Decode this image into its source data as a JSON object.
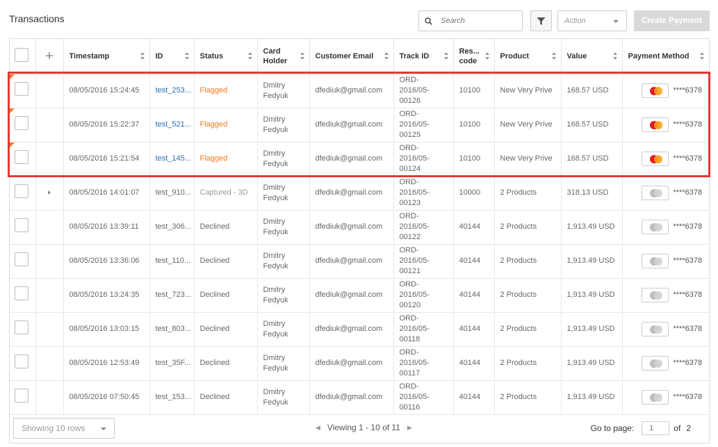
{
  "header": {
    "title": "Transactions",
    "search_placeholder": "Search",
    "action_label": "Action",
    "create_label": "Create Payment"
  },
  "columns": [
    "Timestamp",
    "ID",
    "Status",
    "Card Holder",
    "Customer Email",
    "Track ID",
    "Res... code",
    "Product",
    "Value",
    "Payment Method"
  ],
  "rows": [
    {
      "timestamp": "08/05/2016 15:24:45",
      "id": "test_253...",
      "status": "Flagged",
      "holder": "Dmitry Fedyuk",
      "email": "dfediuk@gmail.com",
      "track": "ORD-2016/05-00126",
      "code": "10100",
      "product": "New Very Prive",
      "value": "168.57 USD",
      "card": "****6378",
      "flagged": true
    },
    {
      "timestamp": "08/05/2016 15:22:37",
      "id": "test_521...",
      "status": "Flagged",
      "holder": "Dmitry Fedyuk",
      "email": "dfediuk@gmail.com",
      "track": "ORD-2016/05-00125",
      "code": "10100",
      "product": "New Very Prive",
      "value": "168.57 USD",
      "card": "****6378",
      "flagged": true
    },
    {
      "timestamp": "08/05/2016 15:21:54",
      "id": "test_145...",
      "status": "Flagged",
      "holder": "Dmitry Fedyuk",
      "email": "dfediuk@gmail.com",
      "track": "ORD-2016/05-00124",
      "code": "10100",
      "product": "New Very Prive",
      "value": "168.57 USD",
      "card": "****6378",
      "flagged": true
    },
    {
      "timestamp": "08/05/2016 14:01:07",
      "id": "test_910...",
      "status": "Captured - 3D",
      "holder": "Dmitry Fedyuk",
      "email": "dfediuk@gmail.com",
      "track": "ORD-2016/05-00123",
      "code": "10000",
      "product": "2 Products",
      "value": "318.13 USD",
      "card": "****6378",
      "flagged": false,
      "expandable": true
    },
    {
      "timestamp": "08/05/2016 13:39:11",
      "id": "test_306...",
      "status": "Declined",
      "holder": "Dmitry Fedyuk",
      "email": "dfediuk@gmail.com",
      "track": "ORD-2016/05-00122",
      "code": "40144",
      "product": "2 Products",
      "value": "1,913.49 USD",
      "card": "****6378",
      "flagged": false
    },
    {
      "timestamp": "08/05/2016 13:36:06",
      "id": "test_110...",
      "status": "Declined",
      "holder": "Dmitry Fedyuk",
      "email": "dfediuk@gmail.com",
      "track": "ORD-2016/05-00121",
      "code": "40144",
      "product": "2 Products",
      "value": "1,913.49 USD",
      "card": "****6378",
      "flagged": false
    },
    {
      "timestamp": "08/05/2016 13:24:35",
      "id": "test_723...",
      "status": "Declined",
      "holder": "Dmitry Fedyuk",
      "email": "dfediuk@gmail.com",
      "track": "ORD-2016/05-00120",
      "code": "40144",
      "product": "2 Products",
      "value": "1,913.49 USD",
      "card": "****6378",
      "flagged": false
    },
    {
      "timestamp": "08/05/2016 13:03:15",
      "id": "test_803...",
      "status": "Declined",
      "holder": "Dmitry Fedyuk",
      "email": "dfediuk@gmail.com",
      "track": "ORD-2016/05-00118",
      "code": "40144",
      "product": "2 Products",
      "value": "1,913.49 USD",
      "card": "****6378",
      "flagged": false
    },
    {
      "timestamp": "08/05/2016 12:53:49",
      "id": "test_35F...",
      "status": "Declined",
      "holder": "Dmitry Fedyuk",
      "email": "dfediuk@gmail.com",
      "track": "ORD-2016/05-00117",
      "code": "40144",
      "product": "2 Products",
      "value": "1,913.49 USD",
      "card": "****6378",
      "flagged": false
    },
    {
      "timestamp": "08/05/2016 07:50:45",
      "id": "test_153...",
      "status": "Declined",
      "holder": "Dmitry Fedyuk",
      "email": "dfediuk@gmail.com",
      "track": "ORD-2016/05-00116",
      "code": "40144",
      "product": "2 Products",
      "value": "1,913.49 USD",
      "card": "****6378",
      "flagged": false
    }
  ],
  "footer": {
    "rows_label": "Showing 10 rows",
    "viewing_label": "Viewing 1 - 10 of 11",
    "goto_label": "Go to page:",
    "current_page": "1",
    "of_label": "of",
    "total_pages": "2"
  },
  "colors": {
    "flagged": "#f5781f",
    "link": "#2a6eb8",
    "highlight": "#e53935"
  },
  "icons": [
    "search-icon",
    "filter-icon",
    "plus-icon",
    "sort-icon",
    "chevron-right-icon",
    "mastercard-icon",
    "chevron-left-icon",
    "chevron-down-icon"
  ]
}
